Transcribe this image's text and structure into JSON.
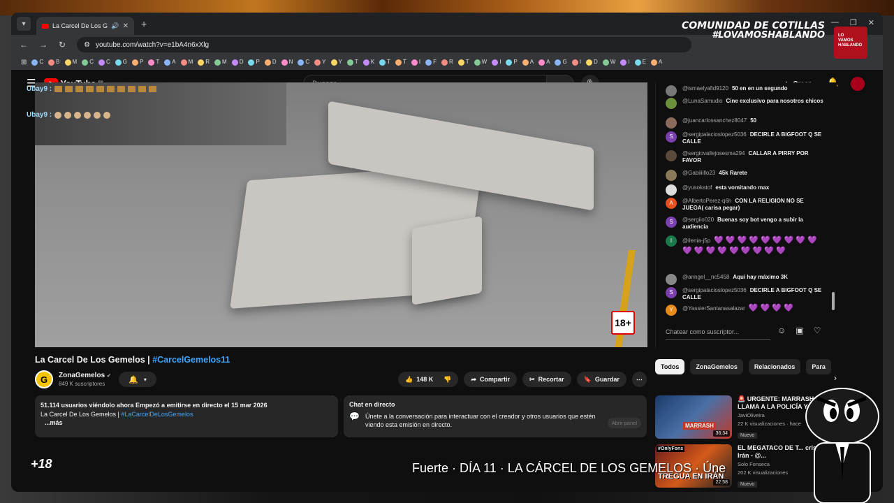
{
  "browser": {
    "tab_title": "La Carcel De Los Gemelos |",
    "url": "youtube.com/watch?v=e1bA4n6xXlg",
    "bookmarks": [
      "C",
      "B",
      "M",
      "C",
      "C",
      "G",
      "P",
      "T",
      "A",
      "M",
      "R",
      "M",
      "D",
      "P",
      "D",
      "N",
      "C",
      "Y",
      "Y",
      "T",
      "K",
      "T",
      "T",
      "I",
      "F",
      "R",
      "T",
      "W",
      "I",
      "P",
      "A",
      "A",
      "G",
      "I",
      "D",
      "W",
      "I",
      "E",
      "A"
    ]
  },
  "youtube": {
    "logo_text": "YouTube",
    "country": "ES",
    "search_placeholder": "Buscar",
    "create_label": "Crear"
  },
  "overlay": {
    "line1": "COMUNIDAD DE COTILLAS",
    "line2": "#LOVAMOSHABLANDO",
    "logo_lines": [
      "LO",
      "VAMOS",
      "HABLANDO"
    ],
    "plus18": "+18",
    "ticker": "Fuerte  ·  DÍA 11  ·  LA CÁRCEL DE LOS GEMELOS  ·  Úne"
  },
  "video": {
    "emote_user1": "Ubay9 :",
    "emote_user2": "Ubay9 :",
    "rating": "18+",
    "title_main": "La Carcel De Los Gemelos | ",
    "title_tag": "#CarcelGemelos11",
    "channel_name": "ZonaGemelos",
    "channel_subs": "849 K suscriptores",
    "channel_initial": "G",
    "likes": "148 K",
    "share": "Compartir",
    "clip": "Recortar",
    "save": "Guardar",
    "description": {
      "stats": "51.114 usuarios viéndolo ahora  Empezó a emitirse en directo el 15 mar 2026",
      "line2_prefix": "La Carcel De Los Gemelos | ",
      "line2_tag": "#LaCarcelDeLosGemelos",
      "more": "...más"
    },
    "chat_panel": {
      "title": "Chat en directo",
      "text": "Únete a la conversación para interactuar con el creador y otros usuarios que estén viendo esta emisión en directo.",
      "button": "Abrir panel"
    }
  },
  "live_chat": {
    "messages": [
      {
        "user": "@ismaelyafid9120",
        "text": "50 en en un segundo",
        "initial": "",
        "color": "#777777"
      },
      {
        "user": "@LunaSamudio",
        "text": "Cine exclusivo para nosotros chicos",
        "initial": "",
        "color": "#6b8f3a"
      },
      {
        "user": "@juancarlossanchez8047",
        "text": "50",
        "initial": "",
        "color": "#8a6a5a"
      },
      {
        "user": "@sergipalacioslopez5036",
        "text": "DECIRLE A BIGFOOT Q SE CALLE",
        "initial": "S",
        "color": "#7b3fb0"
      },
      {
        "user": "@sergiovallejosesma294",
        "text": "CALLAR A PIRRY POR FAVOR",
        "initial": "",
        "color": "#5a4a3a"
      },
      {
        "user": "@Gabiiiillo23",
        "text": "45k Rarete",
        "initial": "",
        "color": "#8a7a5a"
      },
      {
        "user": "@yusokatof",
        "text": "esta vomitando max",
        "initial": "",
        "color": "#dddddd"
      },
      {
        "user": "@AlbertoPerez-q6h",
        "text": "CON LA RELIGION NO SE JUEGA( carisa pegar)",
        "initial": "A",
        "color": "#e6501e"
      },
      {
        "user": "@sergiio020",
        "text": "Buenas soy bot vengo a subir la audiencia",
        "initial": "S",
        "color": "#7b3fb0"
      },
      {
        "user": "@ilenia-j5p",
        "text": "💜 💜 💜 💜 💜 💜 💜 💜 💜 💜 💜 💜 💜 💜 💜 💜 💜 💜",
        "initial": "I",
        "color": "#1b7a4a"
      },
      {
        "user": "@anngel__nc5458",
        "text": "Aqui hay máximo 3K",
        "initial": "",
        "color": "#888888"
      },
      {
        "user": "@sergipalacioslopez5036",
        "text": "DECIRLE A BIGFOOT Q SE CALLE",
        "initial": "S",
        "color": "#7b3fb0"
      },
      {
        "user": "@YassierSantanasalazar",
        "text": "💜 💜 💜 💜",
        "initial": "Y",
        "color": "#e88a1a"
      }
    ],
    "input_placeholder": "Chatear como suscriptor..."
  },
  "chips": [
    "Todos",
    "ZonaGemelos",
    "Relacionados",
    "Para"
  ],
  "recommendations": [
    {
      "title": "🚨 URGENTE: MARRASH LLAMA A LA POLICÍA Y...",
      "channel": "JaviOliveira",
      "meta": "22 K visualizaciones · hace",
      "badge": "Nuevo",
      "duration": "36:34",
      "thumb_text": "MARRASH"
    },
    {
      "title": "EL MEGATACO DE T... crisis con Irán - @...",
      "channel": "Solo Fonseca",
      "meta": "202 K visualizaciones",
      "badge": "Nuevo",
      "duration": "22:58",
      "thumb_text": "TREGUA EN IRÁN",
      "thumb_top_label": "#OnlyFons"
    }
  ],
  "colors": {
    "accent_blue": "#3ea6ff",
    "yt_red": "#ff0000",
    "bg": "#0f0f0f",
    "pill": "#272727"
  }
}
